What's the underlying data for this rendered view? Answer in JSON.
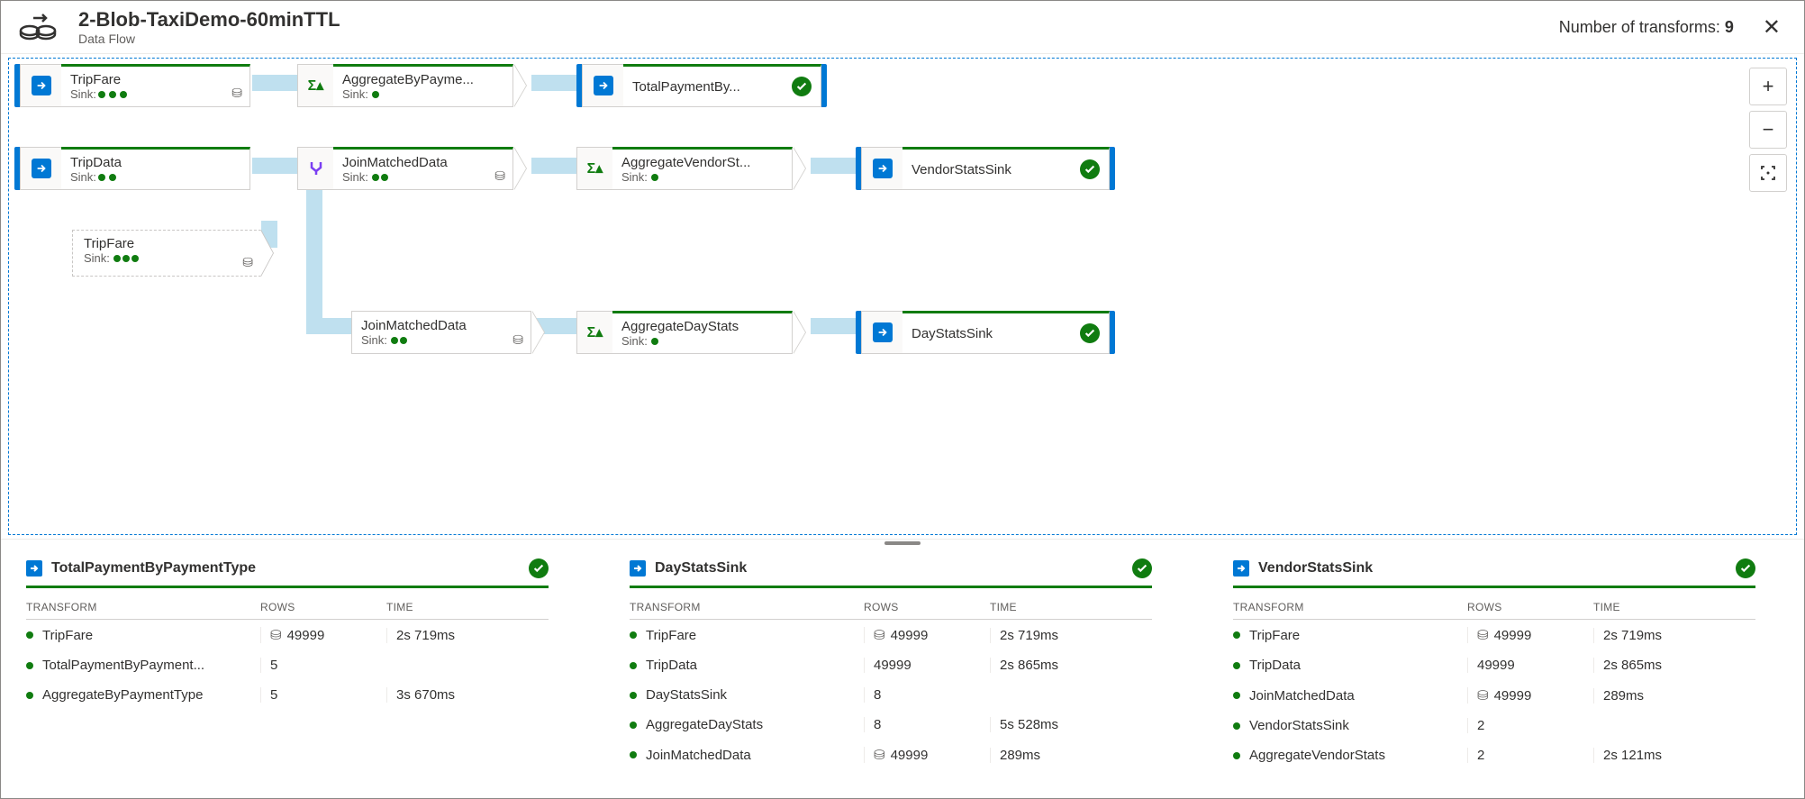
{
  "header": {
    "title": "2-Blob-TaxiDemo-60minTTL",
    "subtitle": "Data Flow",
    "transforms_label": "Number of transforms:",
    "transforms_count": "9"
  },
  "nodes": {
    "tripfare1": {
      "title": "TripFare",
      "sink": "Sink:",
      "dots": 3
    },
    "aggpay": {
      "title": "AggregateByPayme...",
      "sink": "Sink:",
      "dots": 1
    },
    "totalpay": {
      "title": "TotalPaymentBy..."
    },
    "tripdata": {
      "title": "TripData",
      "sink": "Sink:",
      "dots": 2
    },
    "joinmatched1": {
      "title": "JoinMatchedData",
      "sink": "Sink:",
      "dots": 2
    },
    "aggvendor": {
      "title": "AggregateVendorSt...",
      "sink": "Sink:",
      "dots": 1
    },
    "vendorsink": {
      "title": "VendorStatsSink"
    },
    "tripfareghost": {
      "title": "TripFare",
      "sink": "Sink:",
      "dots": 3
    },
    "joinmatched2": {
      "title": "JoinMatchedData",
      "sink": "Sink:",
      "dots": 2
    },
    "aggday": {
      "title": "AggregateDayStats",
      "sink": "Sink:",
      "dots": 1
    },
    "daysink": {
      "title": "DayStatsSink"
    }
  },
  "panels": {
    "cols": {
      "transform": "TRANSFORM",
      "rows": "ROWS",
      "time": "TIME"
    },
    "p1": {
      "title": "TotalPaymentByPaymentType",
      "rows": [
        {
          "name": "TripFare",
          "rows": "49999",
          "time": "2s 719ms",
          "db": true
        },
        {
          "name": "TotalPaymentByPayment...",
          "rows": "5",
          "time": ""
        },
        {
          "name": "AggregateByPaymentType",
          "rows": "5",
          "time": "3s 670ms"
        }
      ]
    },
    "p2": {
      "title": "DayStatsSink",
      "rows": [
        {
          "name": "TripFare",
          "rows": "49999",
          "time": "2s 719ms",
          "db": true
        },
        {
          "name": "TripData",
          "rows": "49999",
          "time": "2s 865ms"
        },
        {
          "name": "DayStatsSink",
          "rows": "8",
          "time": ""
        },
        {
          "name": "AggregateDayStats",
          "rows": "8",
          "time": "5s 528ms"
        },
        {
          "name": "JoinMatchedData",
          "rows": "49999",
          "time": "289ms",
          "db": true
        }
      ]
    },
    "p3": {
      "title": "VendorStatsSink",
      "rows": [
        {
          "name": "TripFare",
          "rows": "49999",
          "time": "2s 719ms",
          "db": true
        },
        {
          "name": "TripData",
          "rows": "49999",
          "time": "2s 865ms"
        },
        {
          "name": "JoinMatchedData",
          "rows": "49999",
          "time": "289ms",
          "db": true
        },
        {
          "name": "VendorStatsSink",
          "rows": "2",
          "time": ""
        },
        {
          "name": "AggregateVendorStats",
          "rows": "2",
          "time": "2s 121ms"
        }
      ]
    }
  }
}
